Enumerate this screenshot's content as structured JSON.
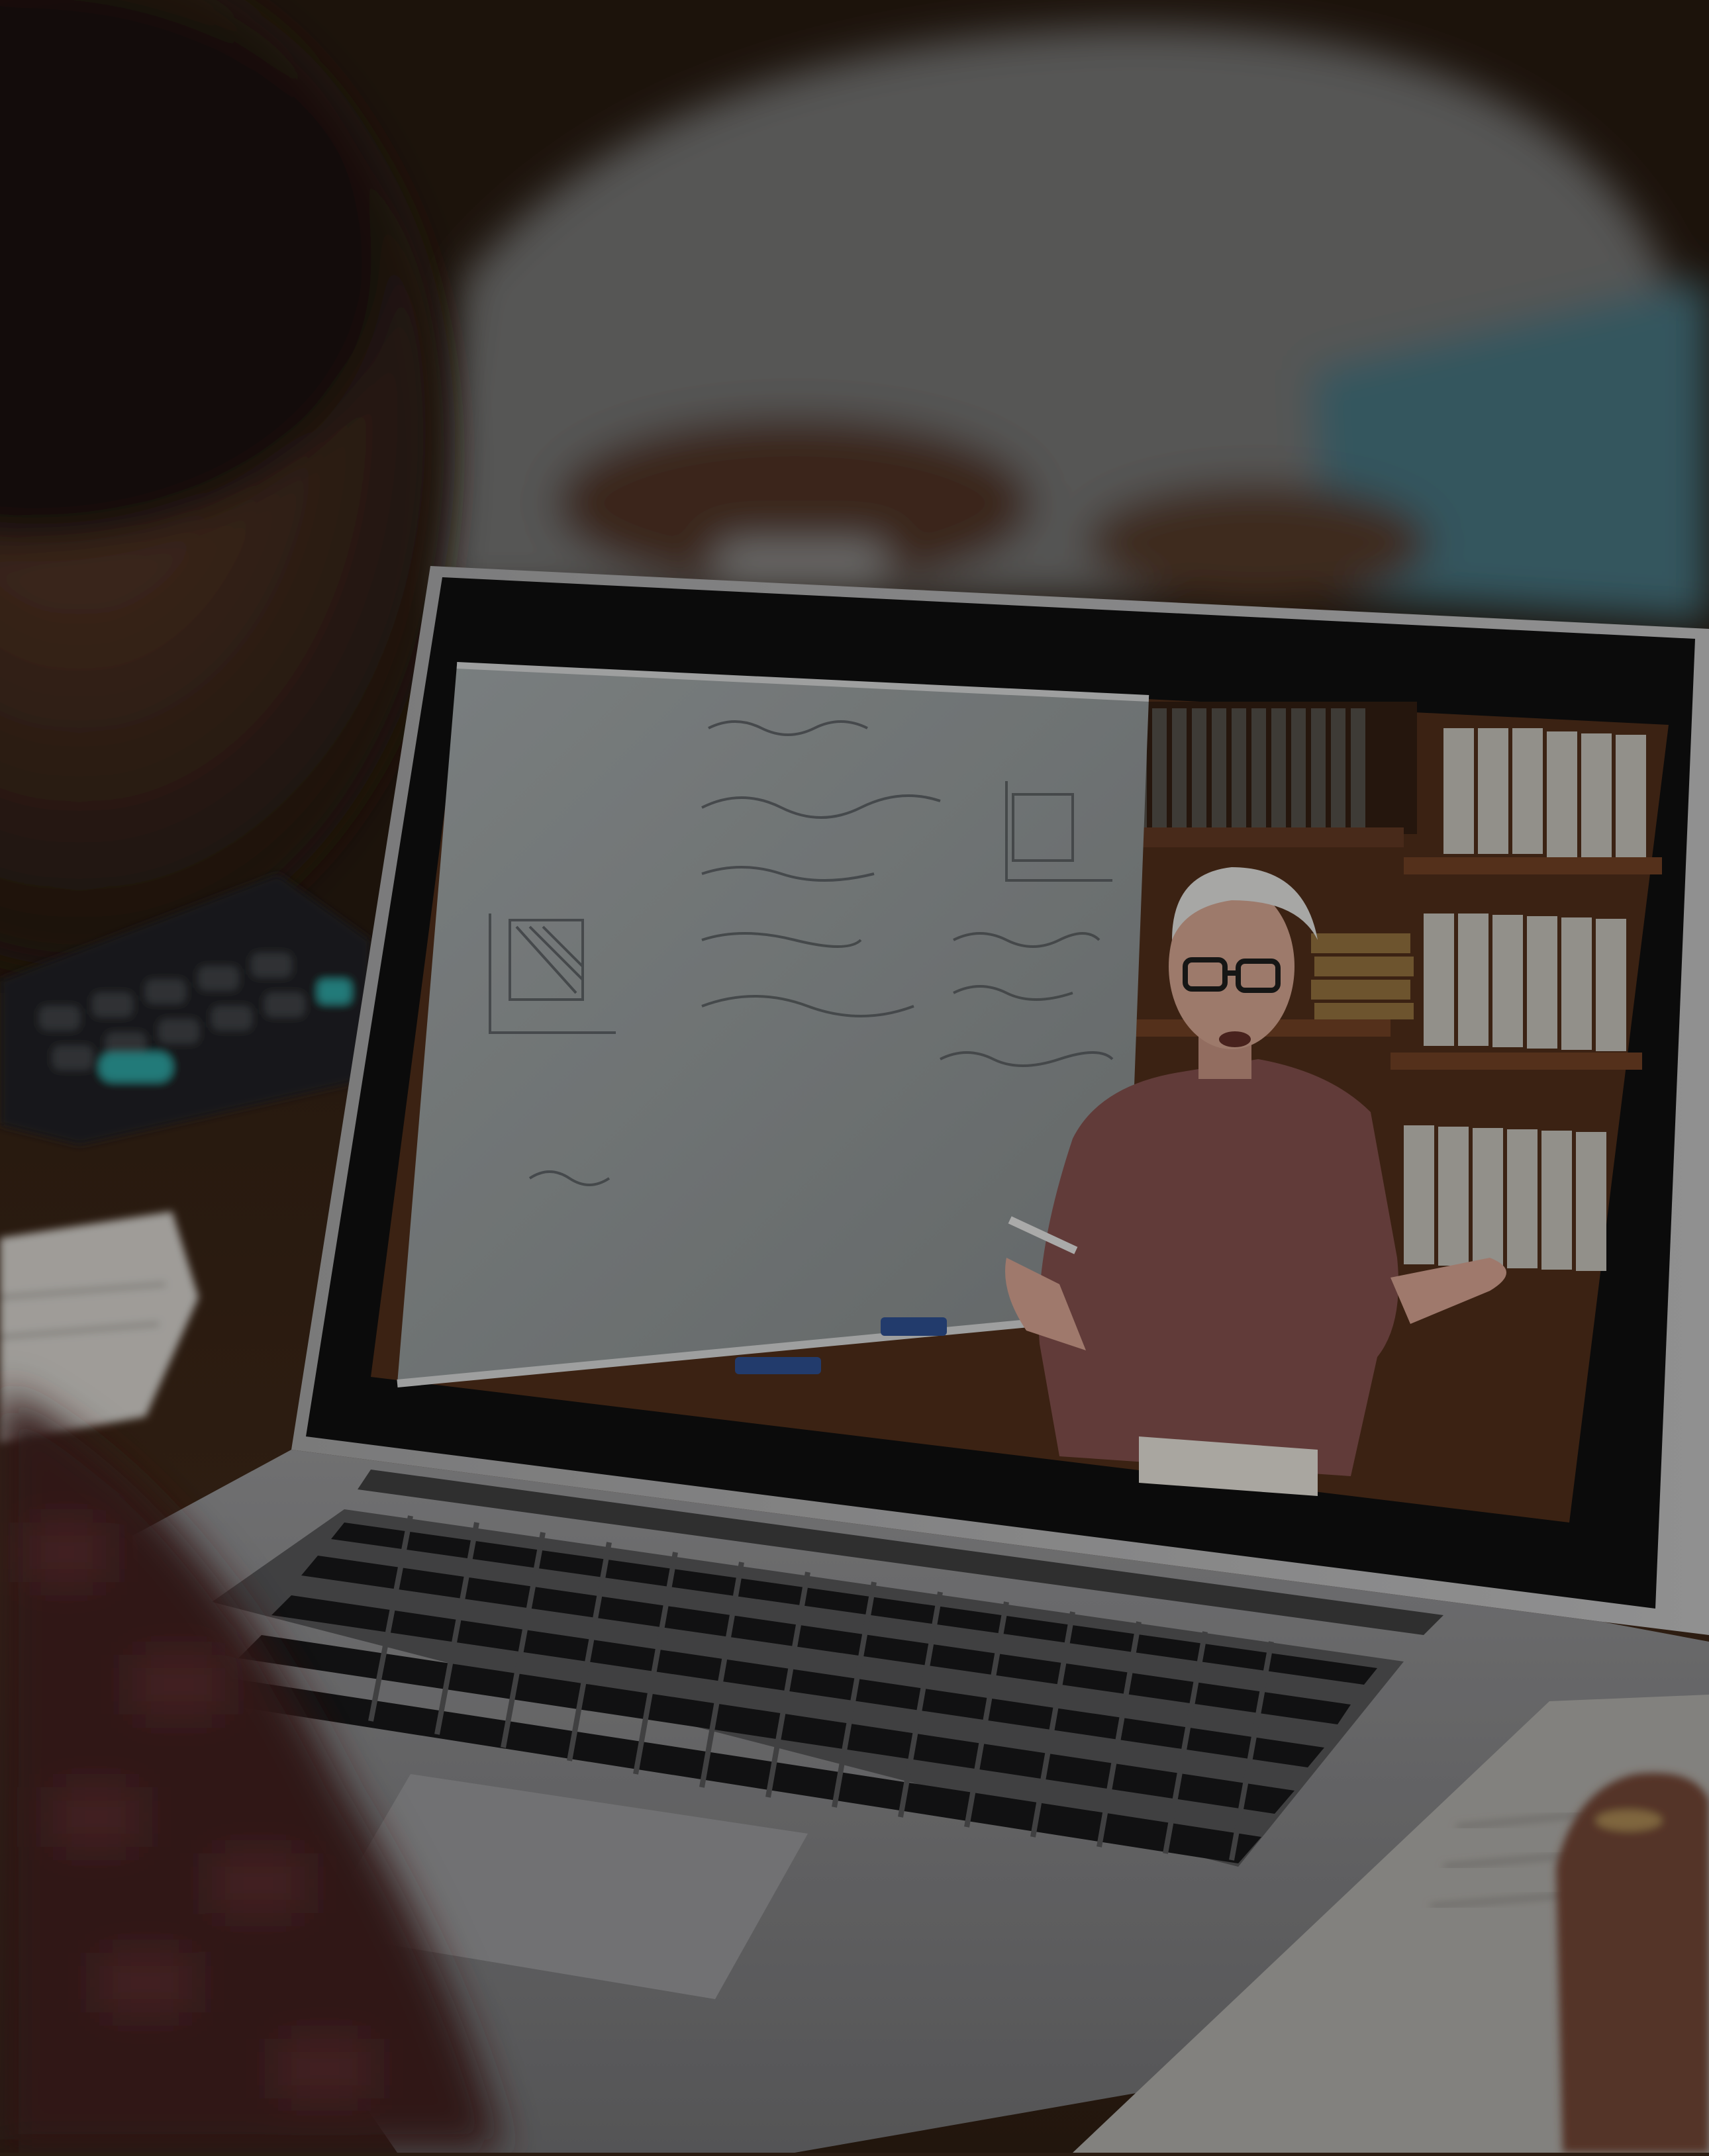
{
  "scene": {
    "description_free": true,
    "colors": {
      "background": "#2a1c12",
      "table": "#3a2416",
      "laptop_body": "#7e7e80",
      "laptop_bezel": "#0c0c0d",
      "screen_whiteboard": "#8c9092",
      "bookshelf": "#4a2a18",
      "blouse": "#7a4a48",
      "calculator": "#1c1f22",
      "calculator_accent": "#2a9a9a",
      "student_sweater": "#6d6d6d",
      "student_sleeve_blue": "#3f6c78"
    },
    "icons": [
      "laptop-icon",
      "calculator-icon",
      "whiteboard-icon",
      "bookshelf-icon",
      "person-icon"
    ]
  }
}
